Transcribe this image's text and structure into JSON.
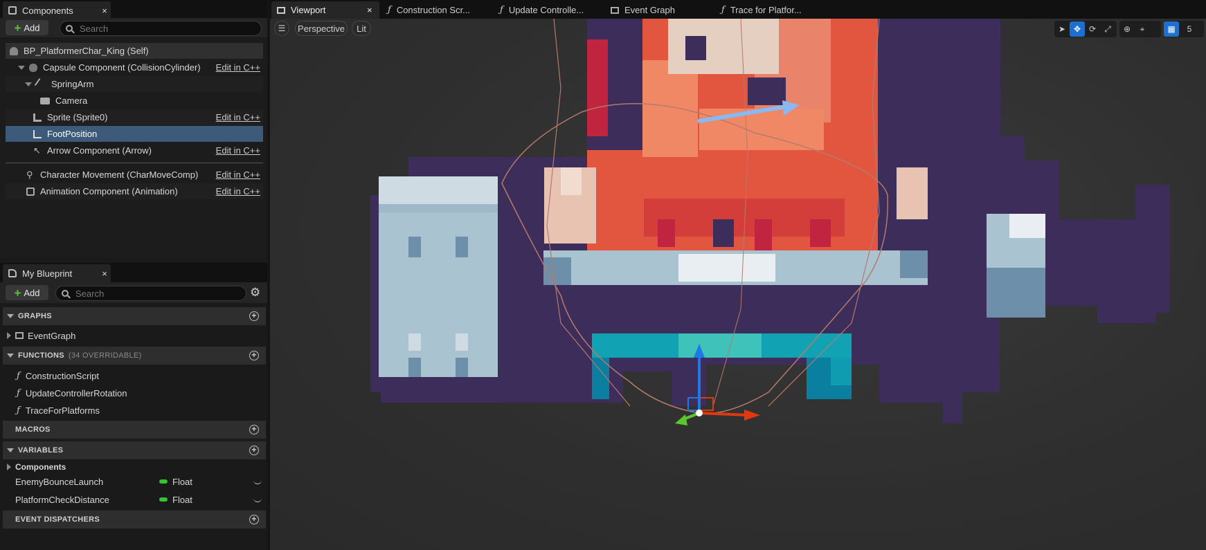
{
  "components_panel": {
    "tab_title": "Components",
    "close_glyph": "×",
    "add_label": "Add",
    "search_placeholder": "Search",
    "items": [
      {
        "label": "BP_PlatformerChar_King (Self)",
        "icon": "character-icon",
        "edit": ""
      },
      {
        "label": "Capsule Component (CollisionCylinder)",
        "icon": "capsule-icon",
        "edit": "Edit in C++"
      },
      {
        "label": "SpringArm",
        "icon": "spring-arm-icon",
        "edit": ""
      },
      {
        "label": "Camera",
        "icon": "camera-icon",
        "edit": ""
      },
      {
        "label": "Sprite (Sprite0)",
        "icon": "sprite-icon",
        "edit": "Edit in C++"
      },
      {
        "label": "FootPosition",
        "icon": "scene-component-icon",
        "edit": ""
      },
      {
        "label": "Arrow Component (Arrow)",
        "icon": "arrow-icon",
        "edit": "Edit in C++"
      },
      {
        "label": "Character Movement (CharMoveComp)",
        "icon": "movement-icon",
        "edit": "Edit in C++"
      },
      {
        "label": "Animation Component (Animation)",
        "icon": "animation-icon",
        "edit": "Edit in C++"
      }
    ]
  },
  "my_blueprint": {
    "tab_title": "My Blueprint",
    "close_glyph": "×",
    "add_label": "Add",
    "search_placeholder": "Search",
    "sections": {
      "graphs": "GRAPHS",
      "functions": "FUNCTIONS",
      "functions_sub": "(34 OVERRIDABLE)",
      "macros": "MACROS",
      "variables": "VARIABLES",
      "dispatchers": "EVENT DISPATCHERS"
    },
    "graphs": [
      "EventGraph"
    ],
    "functions": [
      "ConstructionScript",
      "UpdateControllerRotation",
      "TraceForPlatforms"
    ],
    "variable_category": "Components",
    "variables": [
      {
        "name": "EnemyBounceLaunch",
        "type": "Float"
      },
      {
        "name": "PlatformCheckDistance",
        "type": "Float"
      }
    ]
  },
  "editor_tabs": [
    {
      "label": "Viewport",
      "icon": "viewport-icon",
      "active": true,
      "close": "×"
    },
    {
      "label": "Construction Scr...",
      "icon": "function-icon"
    },
    {
      "label": "Update Controlle...",
      "icon": "function-icon"
    },
    {
      "label": "Event Graph",
      "icon": "graph-icon"
    },
    {
      "label": "Trace for Platfor...",
      "icon": "function-icon"
    }
  ],
  "viewport": {
    "menu_icon": "hamburger-icon",
    "perspective_label": "Perspective",
    "lit_label": "Lit",
    "grid_snap_value": "5"
  },
  "colors": {
    "accent_blue": "#1f6fd1",
    "selection": "#3d5a7a",
    "float_pin": "#35c235",
    "add_plus": "#5dc234"
  }
}
